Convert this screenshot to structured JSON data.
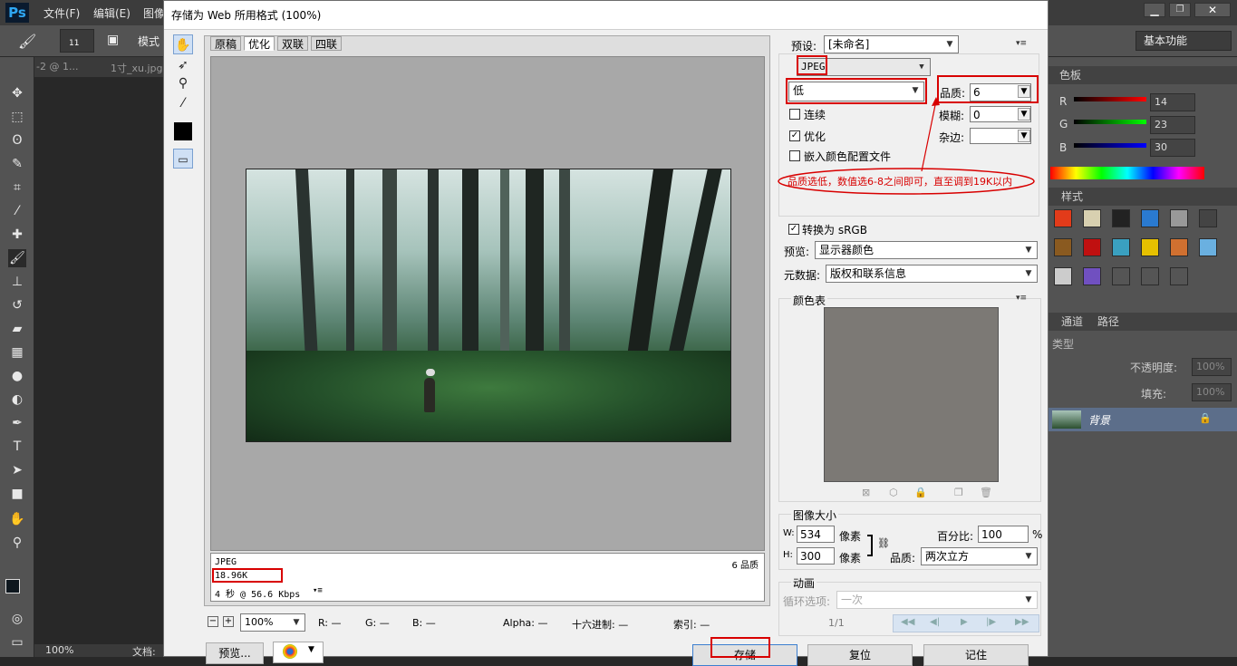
{
  "app": {
    "logo": "Ps",
    "menus": [
      "文件(F)",
      "编辑(E)",
      "图像"
    ],
    "window_controls": [
      "minimize-icon",
      "restore-icon",
      "close-icon"
    ]
  },
  "options_bar": {
    "brush_size": "11",
    "mode_label": "模式",
    "workspace": "基本功能"
  },
  "doc_tabs": [
    "-2 @ 1...",
    "1寸_xu.jpg"
  ],
  "statusbar_ps": {
    "zoom": "100%",
    "doc_label": "文档:"
  },
  "right_panels": {
    "color_tab": "色板",
    "r_label": "R",
    "g_label": "G",
    "b_label": "B",
    "r_value": "14",
    "g_value": "23",
    "b_value": "30",
    "styles_tab": "样式",
    "channels_tab": "通道",
    "paths_tab": "路径",
    "kind_label": "类型",
    "opacity_label": "不透明度:",
    "opacity_value": "100%",
    "fill_label": "填充:",
    "fill_value": "100%",
    "layer_name": "背景"
  },
  "dialog": {
    "title": "存储为 Web 所用格式 (100%)",
    "view_tabs": [
      "原稿",
      "优化",
      "双联",
      "四联"
    ],
    "info": {
      "format": "JPEG",
      "size": "18.96K",
      "time": "4 秒 @ 56.6 Kbps",
      "quality": "6 品质"
    },
    "bottom": {
      "zoom": "100%",
      "r": "R: —",
      "g": "G: —",
      "b": "B: —",
      "alpha": "Alpha: —",
      "hex": "十六进制: —",
      "index": "索引: —"
    },
    "buttons": {
      "preview": "预览...",
      "save": "存储",
      "reset": "复位",
      "remember": "记住"
    },
    "settings": {
      "preset_label": "预设:",
      "preset_value": "[未命名]",
      "format": "JPEG",
      "quality_level": "低",
      "quality_label": "品质:",
      "quality_value": "6",
      "blur_label": "模糊:",
      "blur_value": "0",
      "matte_label": "杂边:",
      "progressive": "连续",
      "optimized": "优化",
      "embed_profile": "嵌入颜色配置文件",
      "annotation": "品质选低，数值选6-8之间即可，直至调到19K以内",
      "convert_srgb": "转换为 sRGB",
      "preview_label": "预览:",
      "preview_value": "显示器颜色",
      "metadata_label": "元数据:",
      "metadata_value": "版权和联系信息",
      "color_table_label": "颜色表",
      "image_size_label": "图像大小",
      "w_label": "W:",
      "w_value": "534",
      "h_label": "H:",
      "h_value": "300",
      "px_unit": "像素",
      "percent_label": "百分比:",
      "percent_value": "100",
      "percent_unit": "%",
      "quality2_label": "品质:",
      "quality2_value": "两次立方",
      "animation_label": "动画",
      "loop_label": "循环选项:",
      "loop_value": "一次",
      "frame": "1/1"
    }
  },
  "colors": {
    "accent_red": "#d80000",
    "ps_bg": "#282828",
    "panel": "#535353"
  }
}
